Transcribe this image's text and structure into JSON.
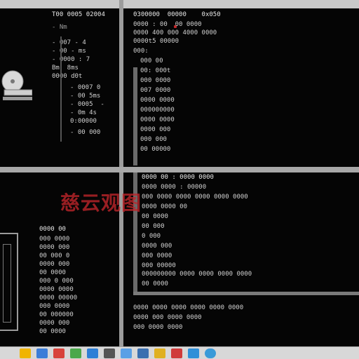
{
  "panes": {
    "tl": {
      "header": "T00 0005 02004",
      "lines": [
        "- Nm",
        "- 007 - 4",
        "- 00 - ms",
        "- 0000 : 7",
        "Bm  8ms",
        "0000 d0t",
        "- 0007 0",
        "- 00 5ms",
        "- 0005  -",
        "- 0m 4s",
        "0:00000",
        "- 00 000"
      ]
    },
    "tr": {
      "header": "0300000  00000    0x050",
      "lines": [
        "0000 : 00  00 0000",
        "0000 400 000 4000 0000",
        "0000t5 00000",
        "000: ",
        "000 00",
        "00: 000t",
        "000 0000",
        "007 0000",
        "0000 0000",
        "000000000",
        "0000 0000",
        "0000 000",
        "000 000",
        "00 00000"
      ]
    },
    "bl": {
      "header": "0000 00",
      "lines": [
        "000 0000",
        "0000 000",
        "00 000 0",
        "0000 000",
        "00 0000",
        "000 0 000",
        "0000 0000",
        "0000 00000",
        "000 0000",
        "00 000000",
        "0000 000",
        "00 0000"
      ]
    },
    "br": {
      "header": "0000 00 : 0000 0000",
      "lines": [
        "0000 0000 : 00000",
        "000 0000 0000 0000 0000 0000",
        "0000 0000 00",
        "00 0000",
        "00 000",
        "0 000",
        "0000 000",
        "000 0000",
        "000 00000",
        "000000000 0000 0000 0000 0000",
        "00 0000"
      ],
      "footer": [
        "0000 0000 0000 0000 0000 0000",
        "0000 000 0000 0000",
        "000 0000 0000"
      ]
    }
  },
  "watermark": "慈云观图",
  "taskbar_icons": [
    "folder-icon",
    "browser-icon",
    "mail-icon",
    "media-icon",
    "settings-icon",
    "terminal-icon",
    "chat-icon",
    "network-icon",
    "image-icon",
    "document-icon",
    "app-icon",
    "globe-icon"
  ],
  "colors": {
    "accent": "#c0282a",
    "pane_bg": "#050505",
    "text": "#cfcfcf"
  }
}
